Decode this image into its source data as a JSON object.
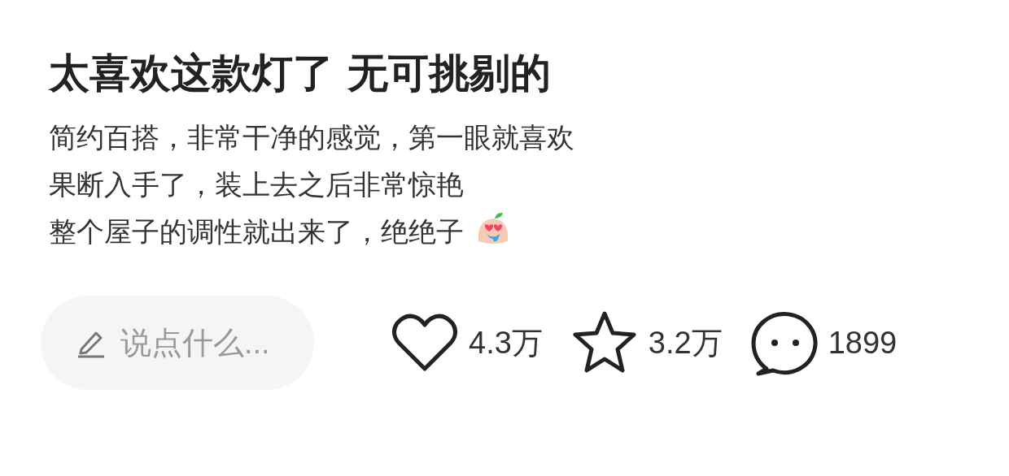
{
  "post": {
    "title": "太喜欢这款灯了 无可挑剔的",
    "lines": [
      "简约百搭，非常干净的感觉，第一眼就喜欢",
      "果断入手了，装上去之后非常惊艳",
      "整个屋子的调性就出来了，绝绝子"
    ]
  },
  "comment_field": {
    "placeholder": "说点什么..."
  },
  "actions": [
    {
      "kind": "like",
      "count": "4.3万"
    },
    {
      "kind": "favorite",
      "count": "3.2万"
    },
    {
      "kind": "comment",
      "count": "1899"
    }
  ]
}
